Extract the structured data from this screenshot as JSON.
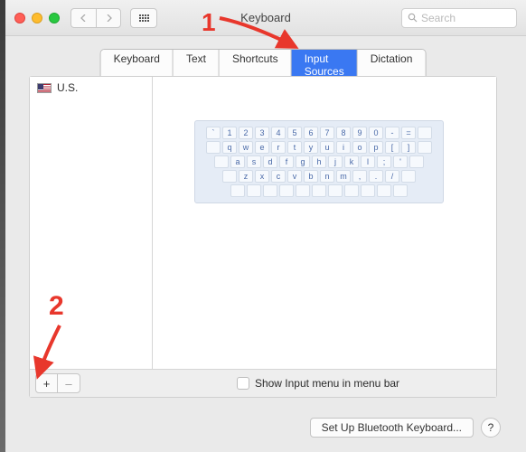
{
  "window": {
    "title": "Keyboard",
    "search_placeholder": "Search"
  },
  "tabs": [
    {
      "id": "keyboard",
      "label": "Keyboard",
      "active": false
    },
    {
      "id": "text",
      "label": "Text",
      "active": false
    },
    {
      "id": "shortcuts",
      "label": "Shortcuts",
      "active": false
    },
    {
      "id": "inputsources",
      "label": "Input Sources",
      "active": true
    },
    {
      "id": "dictation",
      "label": "Dictation",
      "active": false
    }
  ],
  "sources": {
    "items": [
      {
        "name": "U.S.",
        "flag": "us"
      }
    ],
    "add_label": "+",
    "remove_label": "–"
  },
  "preview_keyboard": {
    "rows": [
      [
        "`",
        "1",
        "2",
        "3",
        "4",
        "5",
        "6",
        "7",
        "8",
        "9",
        "0",
        "-",
        "=",
        ""
      ],
      [
        "",
        "q",
        "w",
        "e",
        "r",
        "t",
        "y",
        "u",
        "i",
        "o",
        "p",
        "[",
        "]",
        ""
      ],
      [
        "",
        "a",
        "s",
        "d",
        "f",
        "g",
        "h",
        "j",
        "k",
        "l",
        ";",
        "'",
        ""
      ],
      [
        "",
        "z",
        "x",
        "c",
        "v",
        "b",
        "n",
        "m",
        ",",
        ".",
        "/",
        ""
      ],
      [
        "",
        "",
        "",
        "",
        "",
        "",
        "",
        "",
        "",
        "",
        ""
      ]
    ]
  },
  "show_input_menu": {
    "checked": false,
    "label": "Show Input menu in menu bar"
  },
  "footer": {
    "bluetooth_label": "Set Up Bluetooth Keyboard...",
    "help_label": "?"
  },
  "annotations": {
    "one": "1",
    "two": "2"
  }
}
